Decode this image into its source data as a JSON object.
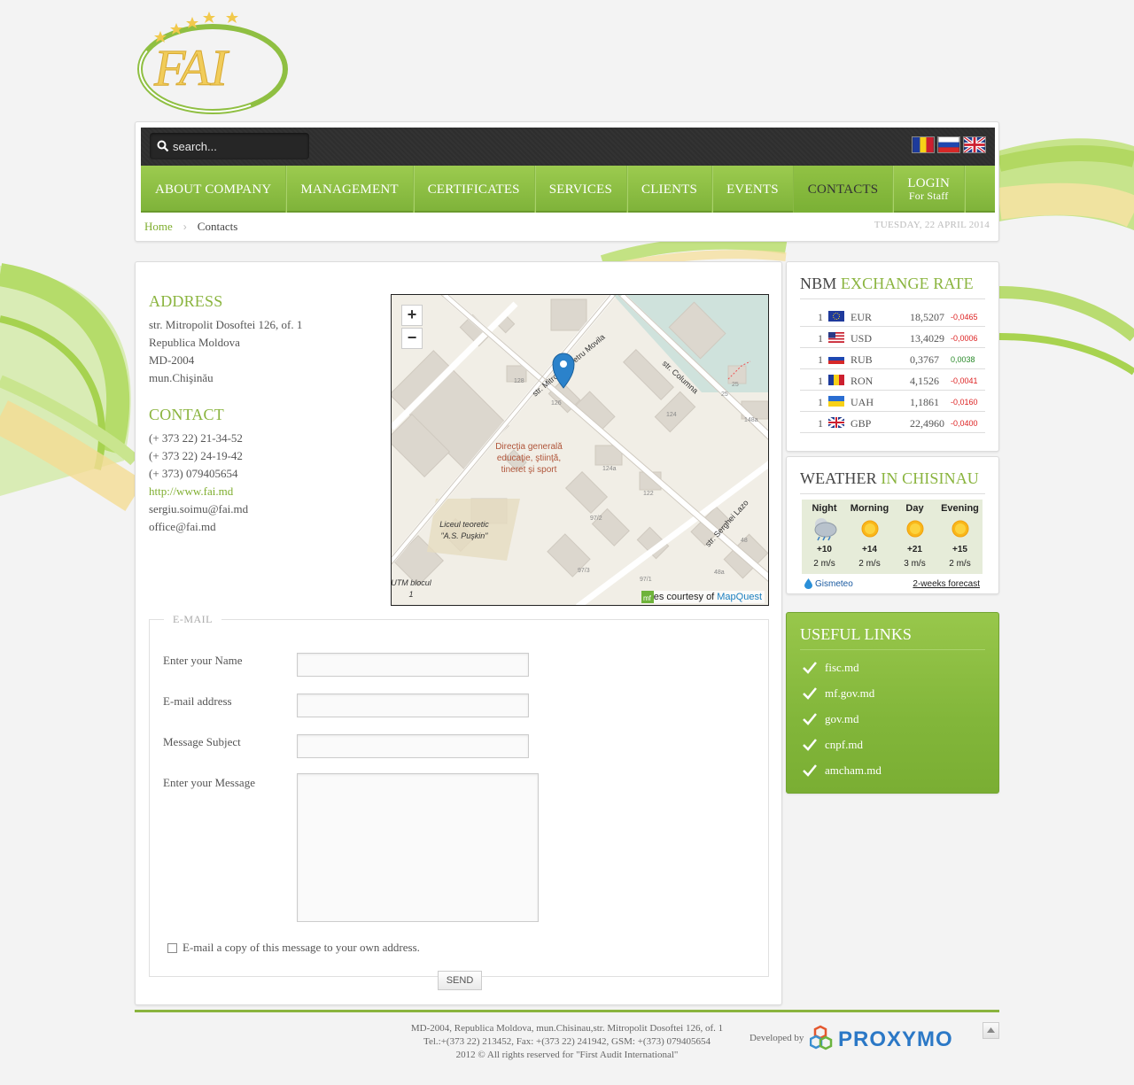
{
  "logo": {
    "text": "FAI"
  },
  "search": {
    "placeholder": "search..."
  },
  "flags": [
    "ro-flag-icon",
    "ru-flag-icon",
    "gb-flag-icon"
  ],
  "nav": [
    {
      "label": "ABOUT COMPANY"
    },
    {
      "label": "MANAGEMENT"
    },
    {
      "label": "CERTIFICATES"
    },
    {
      "label": "SERVICES"
    },
    {
      "label": "CLIENTS"
    },
    {
      "label": "EVENTS"
    },
    {
      "label": "CONTACTS",
      "active": true
    },
    {
      "label": "LOGIN",
      "sub": "For Staff"
    }
  ],
  "breadcrumb": {
    "home": "Home",
    "current": "Contacts"
  },
  "date": "TUESDAY, 22 APRIL 2014",
  "address": {
    "title": "ADDRESS",
    "lines": [
      "str. Mitropolit Dosoftei 126, of. 1",
      "Republica Moldova",
      "MD-2004",
      "mun.Chişinău"
    ]
  },
  "contact": {
    "title": "CONTACT",
    "phone1": "(+ 373 22) 21-34-52",
    "phone2": "(+ 373 22) 24-19-42",
    "phone3": "(+ 373) 079405654",
    "website": "http://www.fai.md",
    "email1": "sergiu.soimu@fai.md",
    "email2": "office@fai.md"
  },
  "map": {
    "zoom_in": "+",
    "zoom_out": "−",
    "labels": {
      "street1": "str. Mitropolit Petru Movila",
      "street2": "str. Columna",
      "street3": "str. Serghei Lazo",
      "poi1_l1": "Direcţia generală",
      "poi1_l2": "educaţie, ştiinţă,",
      "poi1_l3": "tineret şi sport",
      "poi2_l1": "Liceul teoretic",
      "poi2_l2": "\"A.S. Puşkin\"",
      "poi3_l1": "UTM blocul",
      "poi3_l2": "1",
      "n126": "126",
      "n128": "128",
      "n124": "124",
      "n124a": "124a",
      "n122": "122",
      "n25a": "25",
      "n25b": "25",
      "n148a": "148a",
      "n48": "48",
      "n48a": "48a",
      "n972": "97/2",
      "n973": "97/3",
      "n971": "97/1"
    },
    "attribution_prefix": "Tiles courtesy of ",
    "attribution_link": "MapQuest"
  },
  "form": {
    "legend": "E-MAIL",
    "name_label": "Enter your Name",
    "email_label": "E-mail address",
    "subject_label": "Message Subject",
    "message_label": "Enter your Message",
    "copy_label": "E-mail a copy of this message to your own address.",
    "send_label": "SEND"
  },
  "rates": {
    "title_dark": "NBM ",
    "title_green": "EXCHANGE RATE",
    "rows": [
      {
        "n": "1",
        "code": "EUR",
        "value": "18,5207",
        "delta": "-0,0465",
        "up": false
      },
      {
        "n": "1",
        "code": "USD",
        "value": "13,4029",
        "delta": "-0,0006",
        "up": false
      },
      {
        "n": "1",
        "code": "RUB",
        "value": "0,3767",
        "delta": "0,0038",
        "up": true
      },
      {
        "n": "1",
        "code": "RON",
        "value": "4,1526",
        "delta": "-0,0041",
        "up": false
      },
      {
        "n": "1",
        "code": "UAH",
        "value": "1,1861",
        "delta": "-0,0160",
        "up": false
      },
      {
        "n": "1",
        "code": "GBP",
        "value": "22,4960",
        "delta": "-0,0400",
        "up": false
      }
    ]
  },
  "weather": {
    "title_dark": "WEATHER ",
    "title_green": "IN CHISINAU",
    "periods": [
      {
        "label": "Night",
        "temp": "+10",
        "wind": "2 m/s",
        "icon": "cloudy-rain-icon"
      },
      {
        "label": "Morning",
        "temp": "+14",
        "wind": "2 m/s",
        "icon": "sun-icon"
      },
      {
        "label": "Day",
        "temp": "+21",
        "wind": "3 m/s",
        "icon": "sun-icon"
      },
      {
        "label": "Evening",
        "temp": "+15",
        "wind": "2 m/s",
        "icon": "sun-icon"
      }
    ],
    "provider": "Gismeteo",
    "forecast_link": "2-weeks forecast"
  },
  "links": {
    "title": "USEFUL LINKS",
    "items": [
      "fisc.md",
      "mf.gov.md",
      "gov.md",
      "cnpf.md",
      "amcham.md"
    ]
  },
  "footer": {
    "line1": "MD-2004, Republica Moldova, mun.Chisinau,str. Mitropolit Dosoftei 126, of. 1",
    "line2": "Tel.:+(373 22) 213452, Fax: +(373 22) 241942, GSM: +(373) 079405654",
    "line3": "2012 © All rights reserved for \"First Audit International\"",
    "developed_by": "Developed by",
    "developer": "PROXYMO"
  },
  "colors": {
    "accent": "#8ab43e",
    "nav": "#8fc045",
    "topbar": "#333333",
    "negative": "#dd2222",
    "positive": "#2a8a2a"
  }
}
